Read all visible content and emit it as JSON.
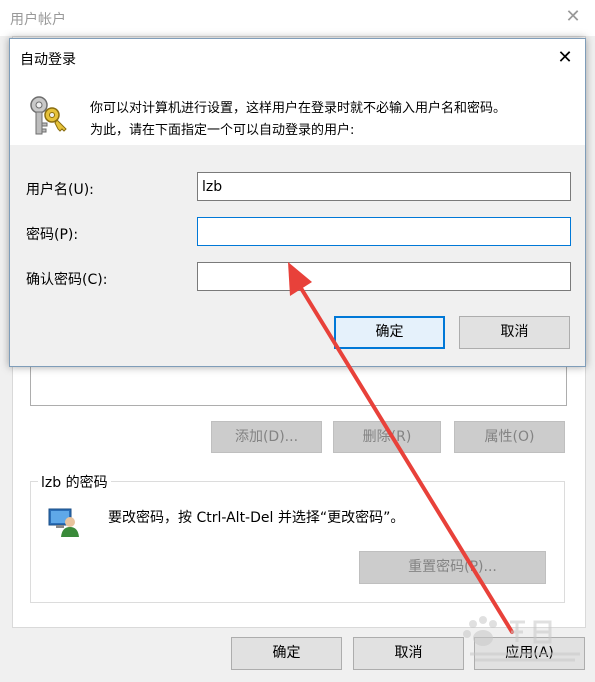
{
  "background_window": {
    "title": "用户帐户",
    "buttons_top": {
      "add": "添加(D)...",
      "remove": "删除(R)",
      "properties": "属性(O)"
    },
    "password_group": {
      "title": "lzb 的密码",
      "instruction": "要改密码，按 Ctrl-Alt-Del 并选择“更改密码”。",
      "reset_button": "重置密码(P)..."
    },
    "footer_buttons": {
      "ok": "确定",
      "cancel": "取消",
      "apply": "应用(A)"
    }
  },
  "dialog": {
    "title": "自动登录",
    "description_line1": "你可以对计算机进行设置，这样用户在登录时就不必输入用户名和密码。",
    "description_line2": "为此，请在下面指定一个可以自动登录的用户:",
    "fields": {
      "username_label": "用户名(U):",
      "username_value": "lzb",
      "password_label": "密码(P):",
      "password_value": "",
      "confirm_label": "确认密码(C):",
      "confirm_value": ""
    },
    "ok_button": "确定",
    "cancel_button": "取消"
  },
  "colors": {
    "accent": "#0078d7",
    "arrow": "#e8413a"
  }
}
